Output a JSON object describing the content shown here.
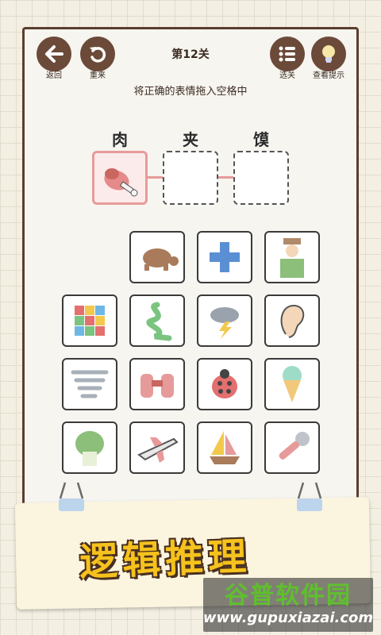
{
  "header": {
    "back_label": "返回",
    "restart_label": "重来",
    "level_title": "第12关",
    "select_level_label": "选关",
    "hint_label": "查看提示"
  },
  "instruction": "将正确的表情拖入空格中",
  "puzzle": {
    "characters": [
      "肉",
      "夹",
      "馍"
    ],
    "slots": [
      "meat-icon",
      "",
      ""
    ]
  },
  "tiles": [
    "turtle-icon",
    "plus-icon",
    "farmer-icon",
    "rubiks-cube-icon",
    "snake-icon",
    "thunderstorm-icon",
    "ear-icon",
    "tornado-icon",
    "binoculars-icon",
    "ladybug-icon",
    "ice-cream-icon",
    "cabbage-icon",
    "airplane-icon",
    "sailboat-icon",
    "microphone-icon"
  ],
  "banner": {
    "text": "逻辑推理"
  },
  "watermark": {
    "title": "谷普软件园",
    "url": "www.gupuxiazai.com"
  },
  "colors": {
    "button_brown": "#6b4a3a",
    "slot_pink": "#e79a9a",
    "banner_yellow": "#f6c21c",
    "watermark_green": "#5fbf2e"
  }
}
